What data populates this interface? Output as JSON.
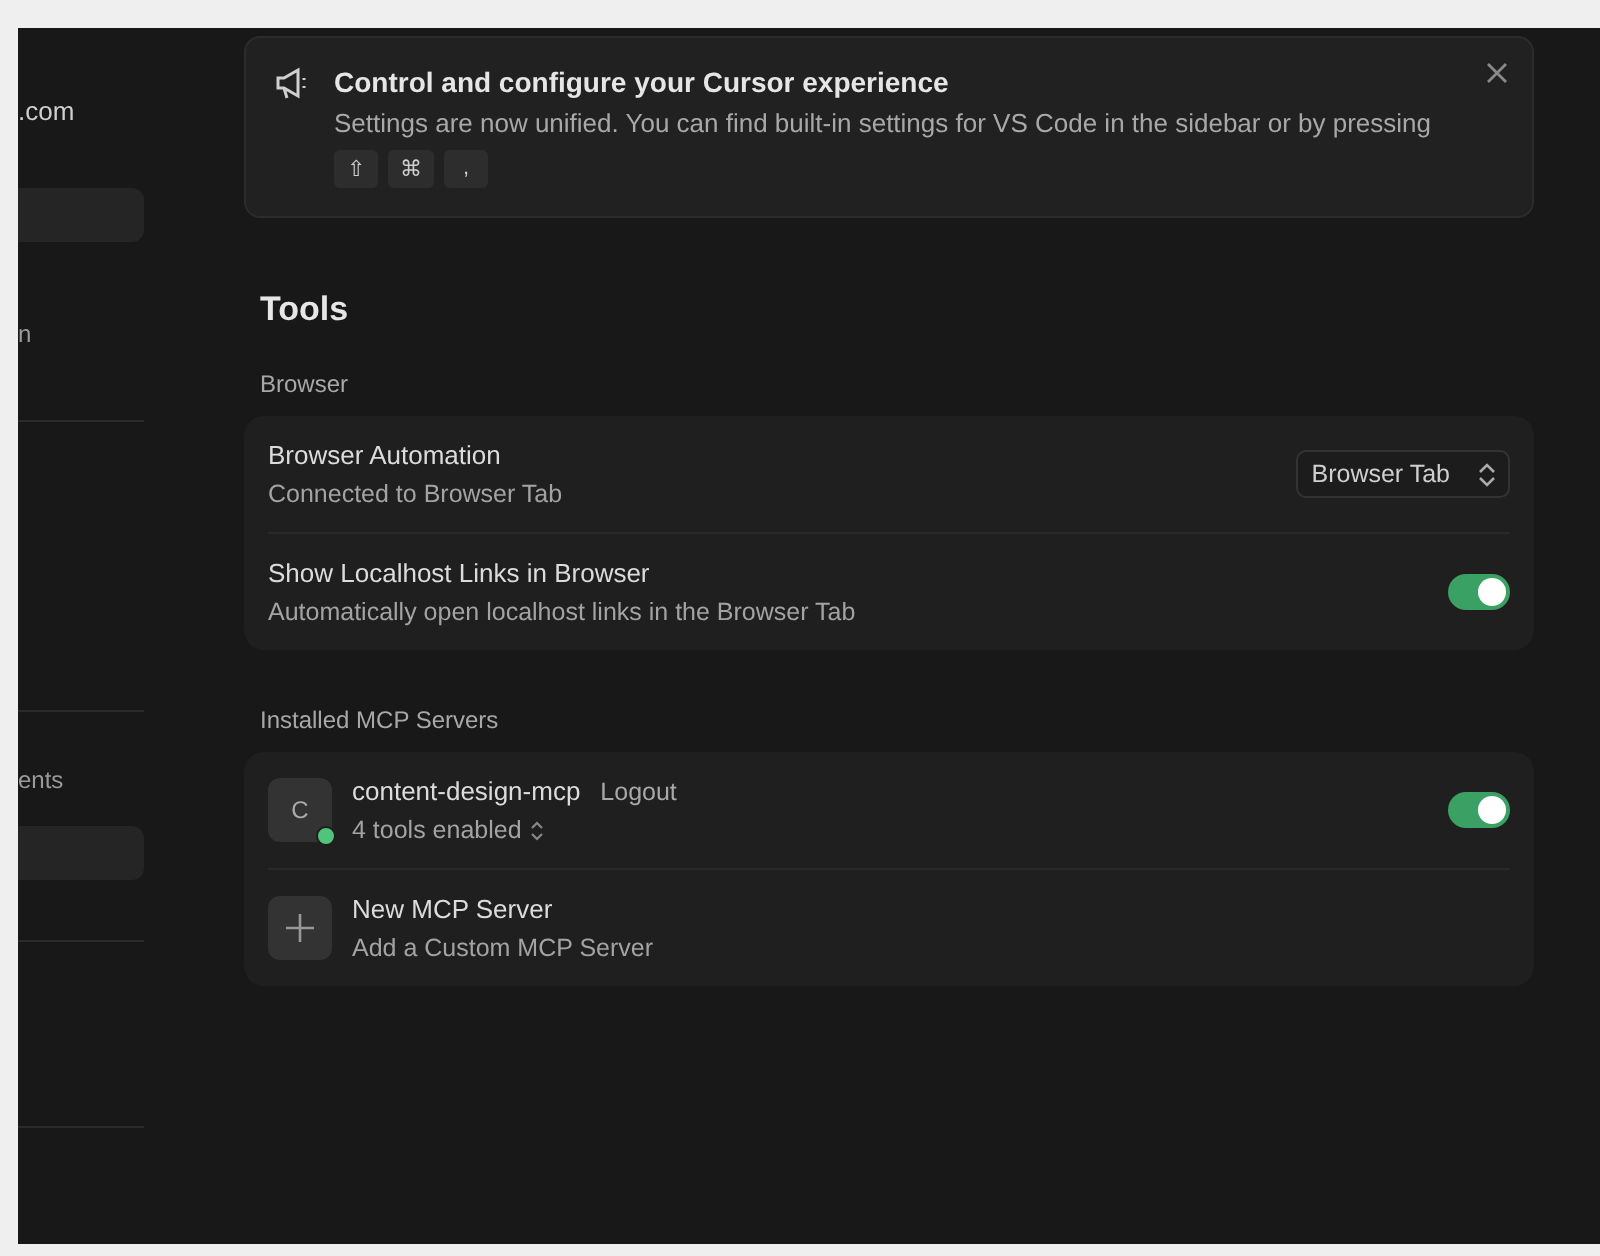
{
  "sidebar": {
    "account": ".com",
    "items": [
      {
        "selected": true
      },
      {
        "label": "n",
        "selected": false
      },
      {
        "label": "ents",
        "selected": false
      },
      {
        "selected": true
      }
    ]
  },
  "banner": {
    "title": "Control and configure your Cursor experience",
    "text": "Settings are now unified. You can find built-in settings for VS Code in the sidebar or by pressing",
    "keys": [
      "⇧",
      "⌘",
      ","
    ]
  },
  "page_title": "Tools",
  "sections": [
    {
      "heading": "Browser",
      "rows": [
        {
          "kind": "select",
          "title": "Browser Automation",
          "subtitle": "Connected to Browser Tab",
          "value": "Browser Tab"
        },
        {
          "kind": "toggle",
          "title": "Show Localhost Links in Browser",
          "subtitle": "Automatically open localhost links in the Browser Tab",
          "on": true
        }
      ]
    },
    {
      "heading": "Installed MCP Servers",
      "rows": [
        {
          "kind": "server",
          "avatar": "C",
          "title": "content-design-mcp",
          "action": "Logout",
          "subtitle": "4 tools enabled",
          "color": "#4fc47a",
          "on": true
        },
        {
          "kind": "add",
          "title": "New MCP Server",
          "subtitle": "Add a Custom MCP Server"
        }
      ]
    }
  ]
}
